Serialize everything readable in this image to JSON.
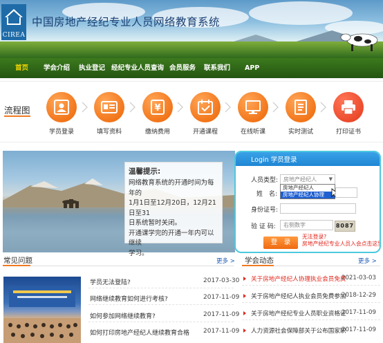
{
  "header": {
    "logo_text": "CIREA",
    "site_title": "中国房地产经纪专业人员网络教育系统"
  },
  "nav": {
    "items": [
      {
        "label": "首页",
        "active": true
      },
      {
        "label": "学会介绍"
      },
      {
        "label": "执业登记"
      },
      {
        "label": "经纪专业人员查询"
      },
      {
        "label": "会员服务"
      },
      {
        "label": "联系我们"
      },
      {
        "label": "APP"
      }
    ]
  },
  "flow": {
    "title": "流程图",
    "steps": [
      {
        "label": "学员登录",
        "icon": "user-card-icon"
      },
      {
        "label": "填写资料",
        "icon": "id-card-icon"
      },
      {
        "label": "缴纳费用",
        "icon": "yen-icon"
      },
      {
        "label": "开通课程",
        "icon": "calendar-icon"
      },
      {
        "label": "在线听课",
        "icon": "monitor-icon"
      },
      {
        "label": "实时测试",
        "icon": "document-icon"
      },
      {
        "label": "打印证书",
        "icon": "printer-icon"
      }
    ]
  },
  "notice": {
    "title": "温馨提示:",
    "lines": [
      "网络教育系统的开通时间为每年的",
      "1月1日至12月20日，12月21日至31",
      "日系统暂时关闭。",
      "开通课学完的开通一年内可以继续",
      "学习。"
    ]
  },
  "login": {
    "title": "Login 学员登录",
    "type_label": "人员类型:",
    "type_value": "房地产经纪人",
    "options": [
      "房地产经纪人",
      "房地产经纪人协理"
    ],
    "selected_option": 1,
    "name_label": "姓　名:",
    "id_label": "身份证号:",
    "captcha_label": "验 证 码:",
    "captcha_placeholder": "右侧数字",
    "captcha_code": "8087",
    "submit_label": "登　录",
    "forgot_line1": "无法登录?",
    "forgot_line2": "房地产经纪专业人员入会点击这里"
  },
  "faq": {
    "title": "常见问题",
    "more": "更多 >",
    "items": [
      {
        "text": "学员无法登陆?",
        "date": "2017-03-30"
      },
      {
        "text": "网络继续教育如何进行考核?",
        "date": "2017-11-09"
      },
      {
        "text": "如何参加网络继续教育?",
        "date": "2017-11-09"
      },
      {
        "text": "如何打印房地产经纪人继续教育合格",
        "date": "2017-11-09"
      }
    ]
  },
  "news": {
    "title": "学会动态",
    "more": "更多 >",
    "items": [
      {
        "text": "关于房地产经纪人协理执业会员免费",
        "date": "2021-03-03",
        "highlight": true
      },
      {
        "text": "关于房地产经纪人执业会员免费参加",
        "date": "2018-12-29",
        "highlight": false
      },
      {
        "text": "关于房地产经纪专业人员职业资格证",
        "date": "2017-11-09",
        "highlight": false
      },
      {
        "text": "人力资源社会保障部关于公布国家职",
        "date": "2017-11-09",
        "highlight": false
      }
    ]
  },
  "colors": {
    "brand_blue": "#1e6ba8",
    "nav_green": "#2e6a18",
    "accent_orange": "#f07a22",
    "highlight_red": "#e0261b",
    "login_border": "#4bc9df"
  }
}
